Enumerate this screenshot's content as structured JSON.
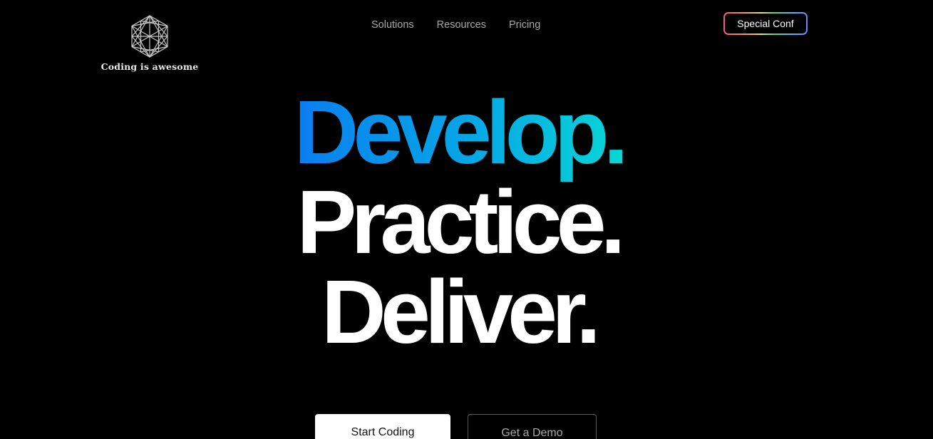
{
  "brand": {
    "logo_icon": "geodesic-hexagon-icon",
    "name": "Coding is awesome"
  },
  "nav": {
    "items": [
      "Solutions",
      "Resources",
      "Pricing"
    ]
  },
  "header": {
    "cta_label": "Special Conf"
  },
  "hero": {
    "line1": "Develop.",
    "line2": "Practice.",
    "line3": "Deliver."
  },
  "actions": {
    "primary_label": "Start Coding",
    "secondary_label": "Get a Demo"
  },
  "colors": {
    "background": "#000000",
    "gradient_start": "#0a7ef0",
    "gradient_end": "#08d6d6",
    "nav_text": "#a8a8a8"
  }
}
